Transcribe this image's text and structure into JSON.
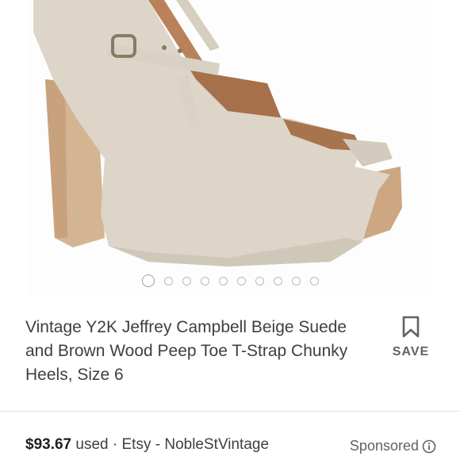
{
  "carousel": {
    "image_alt": "Beige suede peep toe T-strap chunky platform heels with wooden heel",
    "dot_count": 10,
    "active_index": 0
  },
  "listing": {
    "title": "Vintage Y2K Jeffrey Campbell Beige Suede and Brown Wood Peep Toe T-Strap Chunky Heels, Size 6",
    "price": "$93.67",
    "condition": "used",
    "separator1": "·",
    "marketplace": "Etsy",
    "separator2": "-",
    "seller": "NobleStVintage"
  },
  "save": {
    "label": "SAVE",
    "icon": "bookmark-icon"
  },
  "ad": {
    "label": "Sponsored",
    "icon": "info-icon"
  },
  "colors": {
    "suede": "#dcd5c8",
    "wood": "#c9a57f",
    "text": "#3c4043"
  }
}
